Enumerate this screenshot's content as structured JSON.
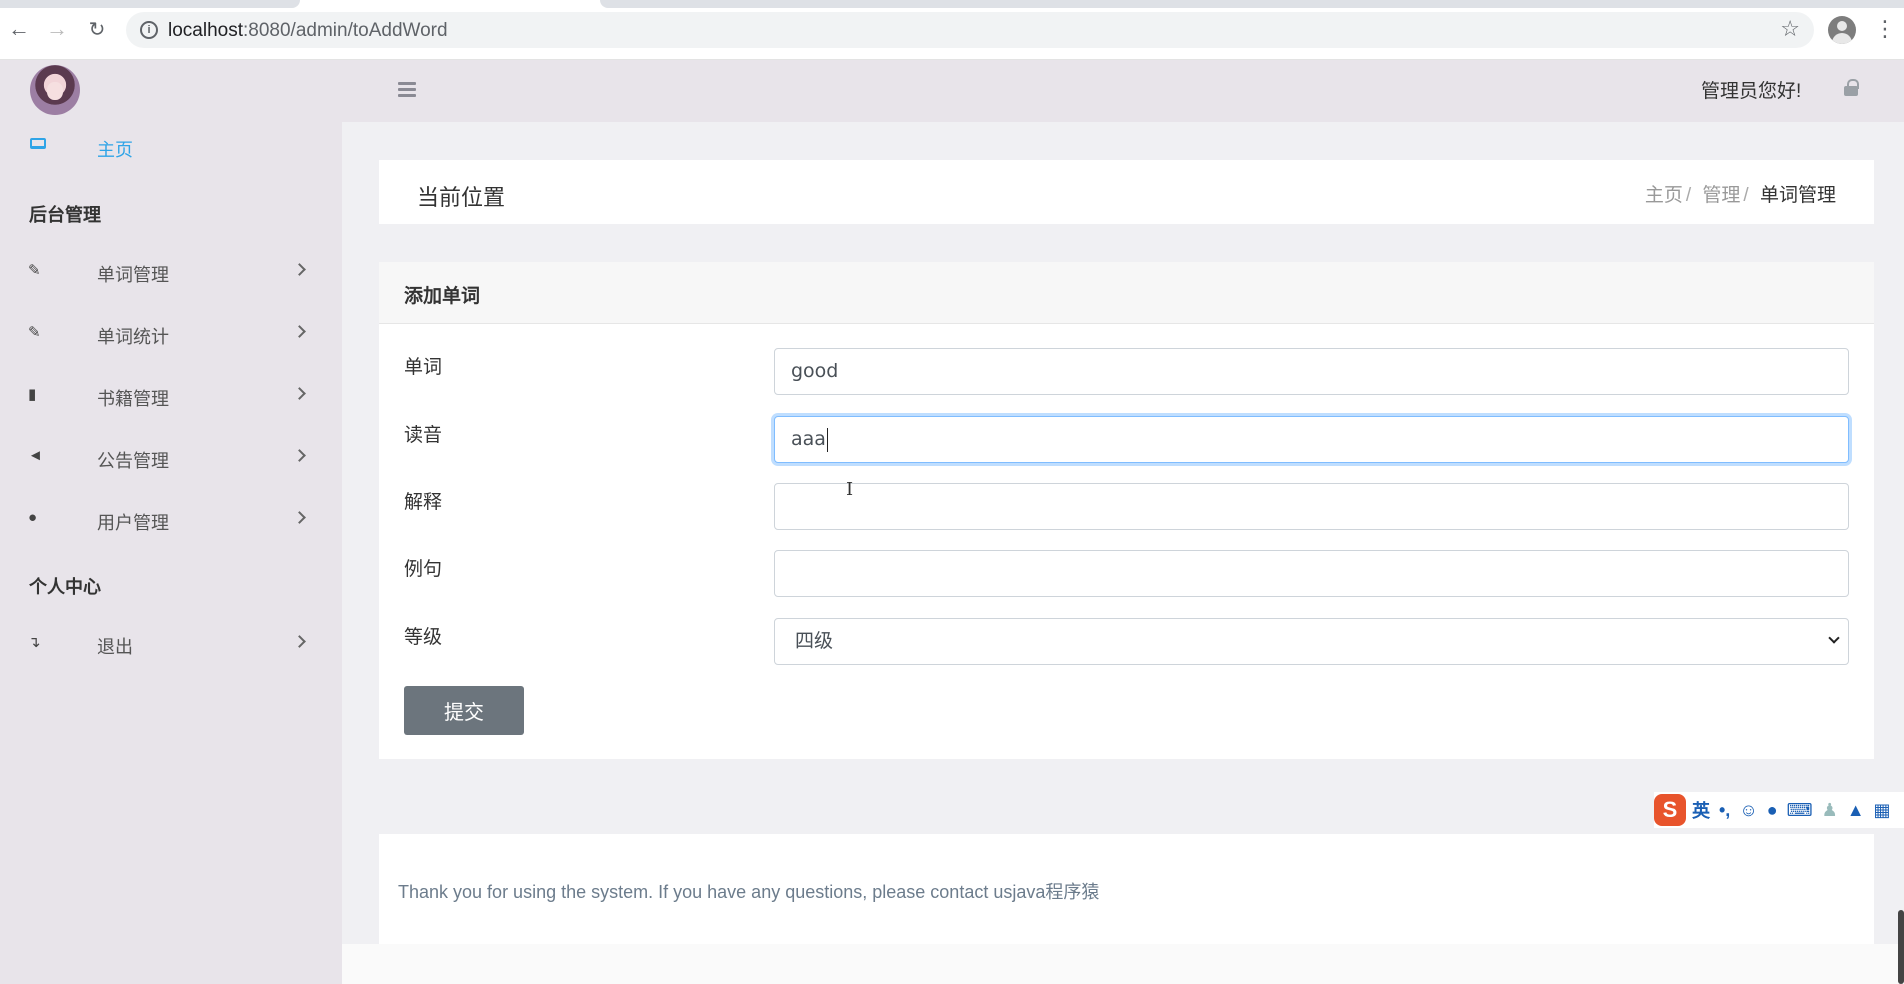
{
  "browser": {
    "url_host": "localhost",
    "url_rest": ":8080/admin/toAddWord"
  },
  "sidebar": {
    "home_label": "主页",
    "group_admin": "后台管理",
    "items": [
      {
        "label": "单词管理",
        "icon": "edit-icon"
      },
      {
        "label": "单词统计",
        "icon": "edit-icon"
      },
      {
        "label": "书籍管理",
        "icon": "book-icon"
      },
      {
        "label": "公告管理",
        "icon": "bullhorn-icon"
      },
      {
        "label": "用户管理",
        "icon": "user-icon"
      }
    ],
    "group_personal": "个人中心",
    "logout_label": "退出"
  },
  "header": {
    "greeting": "管理员您好!"
  },
  "breadcrumb": {
    "title": "当前位置",
    "items": [
      "主页",
      "管理",
      "单词管理"
    ]
  },
  "form": {
    "title": "添加单词",
    "fields": [
      {
        "label": "单词",
        "value": "good"
      },
      {
        "label": "读音",
        "value": "aaa"
      },
      {
        "label": "解释",
        "value": ""
      },
      {
        "label": "例句",
        "value": ""
      }
    ],
    "level_label": "等级",
    "level_value": "四级",
    "submit_label": "提交"
  },
  "footer": {
    "text": "Thank you for using the system. If you have any questions, please contact usjava程序猿"
  },
  "ime": {
    "logo": "S",
    "mode": "英"
  },
  "colors": {
    "accent": "#2fa4e7",
    "sidebar_bg": "#e8e4ea",
    "button_bg": "#6c757d"
  }
}
